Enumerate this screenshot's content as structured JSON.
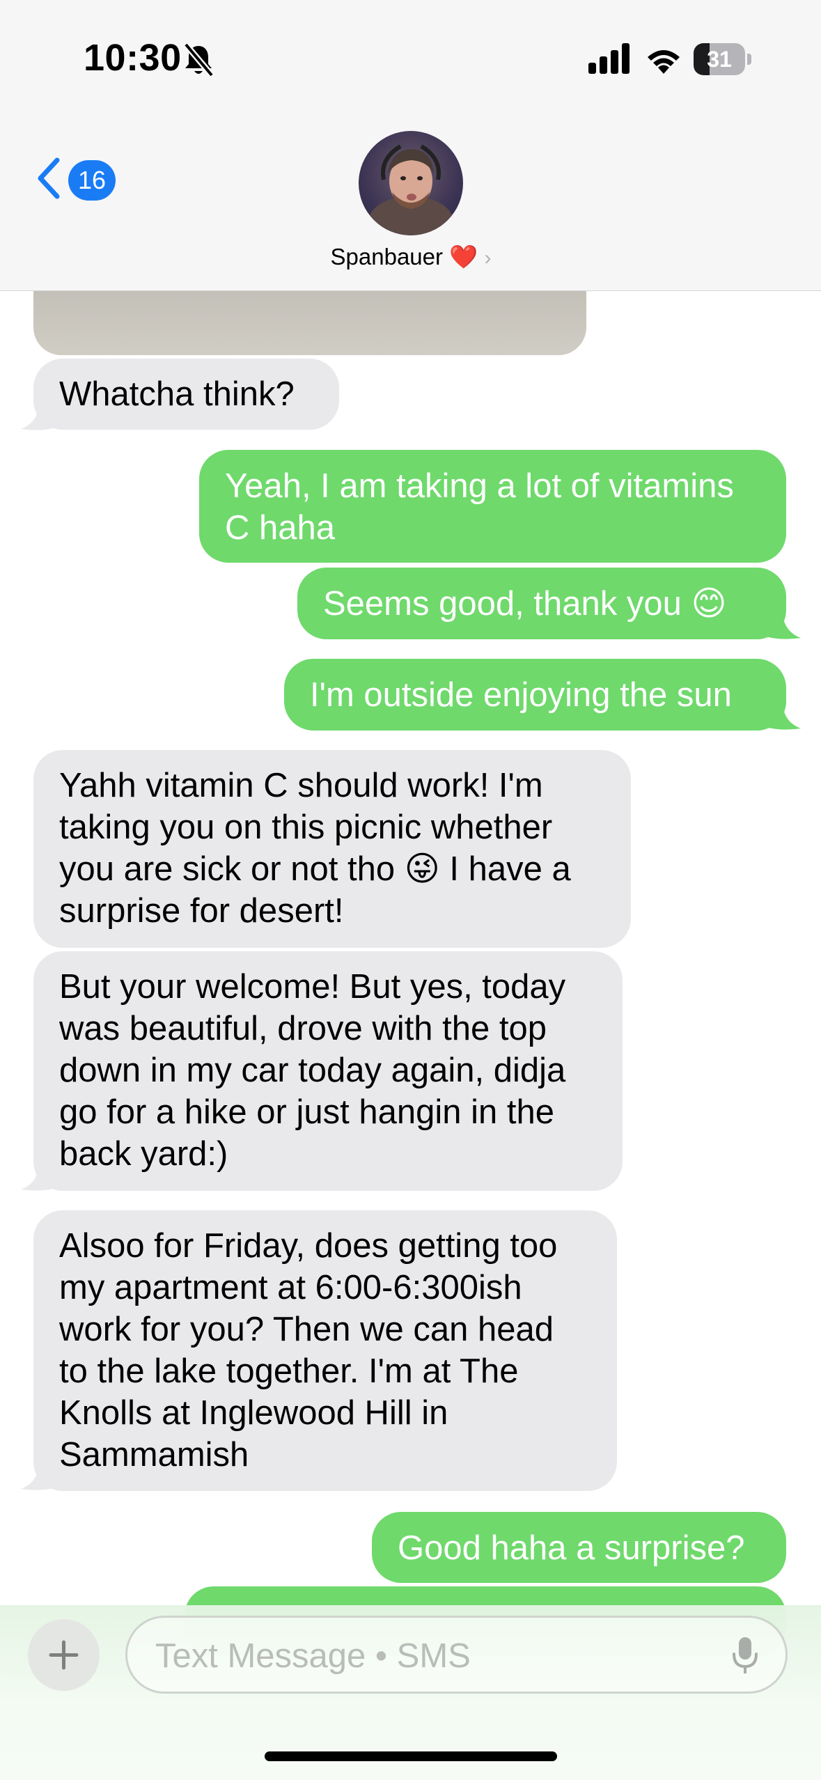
{
  "status_bar": {
    "time": "10:30",
    "battery_level": "31",
    "battery_fraction": 0.31
  },
  "header": {
    "back_count": "16",
    "contact_name": "Spanbauer",
    "contact_emoji": "❤️",
    "chevron": "›"
  },
  "messages": [
    {
      "side": "in",
      "text": "Whatcha think?"
    },
    {
      "side": "out",
      "text": "Yeah, I am taking a lot of vitamins C haha"
    },
    {
      "side": "out",
      "text": "Seems good, thank you 😊"
    },
    {
      "side": "out",
      "text": "I'm outside enjoying the sun"
    },
    {
      "side": "in",
      "text": "Yahh vitamin C should work! I'm taking you on this picnic whether you are sick or not tho 😜 I have a surprise for desert!"
    },
    {
      "side": "in",
      "text": "But your welcome! But yes, today was beautiful, drove with the top down in my car today again, didja go for a hike or just hangin in the back yard:)"
    },
    {
      "side": "in",
      "text": "Alsoo for Friday, does getting too my apartment at 6:00-6:300ish work for you? Then we can head to the lake together. I'm at The Knolls at Inglewood Hill in Sammamish"
    },
    {
      "side": "out",
      "text": "Good haha a surprise?"
    }
  ],
  "composer": {
    "placeholder": "Text Message • SMS"
  },
  "colors": {
    "sms_green": "#6fd96c",
    "incoming_gray": "#e9e9eb",
    "ios_blue": "#1a7cf5"
  },
  "icons": [
    "bell-slash-icon",
    "signal-icon",
    "wifi-icon",
    "battery-icon",
    "chevron-left-icon",
    "plus-icon",
    "mic-icon"
  ]
}
